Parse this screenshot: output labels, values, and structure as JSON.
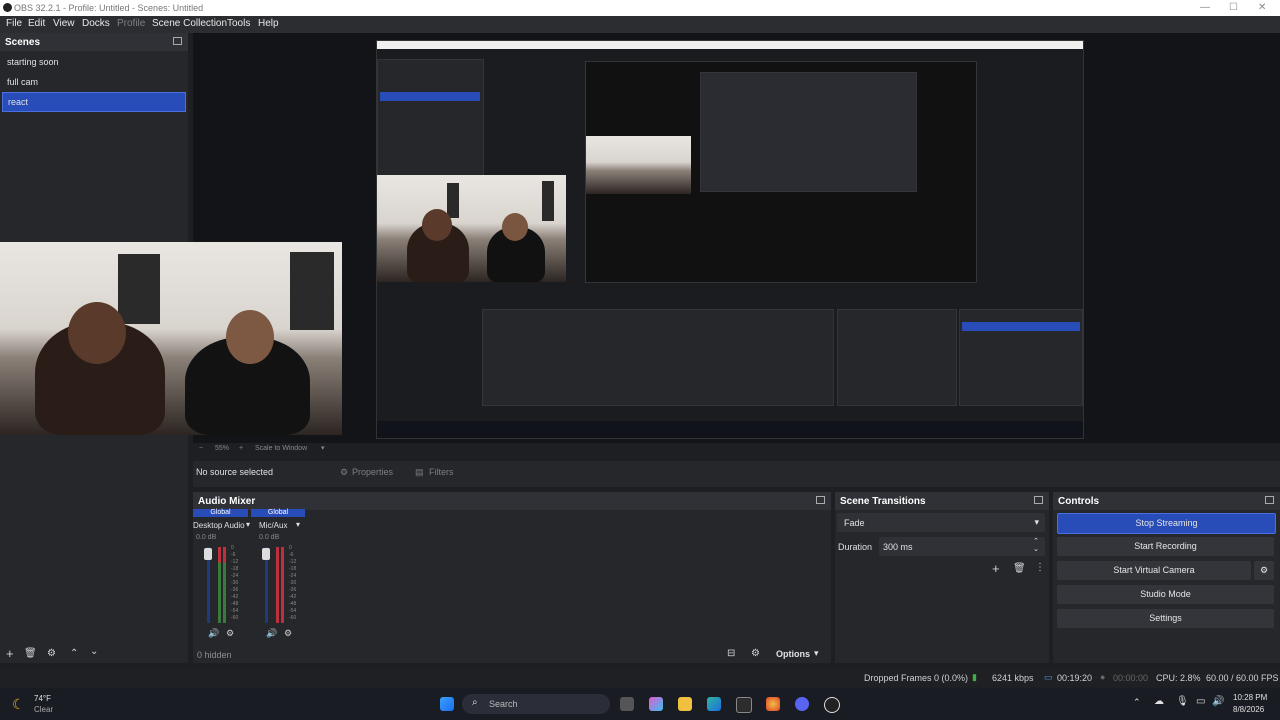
{
  "window": {
    "title": "OBS 32.2.1 - Profile: Untitled - Scenes: Untitled"
  },
  "menu": [
    "File",
    "Edit",
    "View",
    "Docks",
    "Profile",
    "Scene Collection",
    "Tools",
    "Help"
  ],
  "scenes": {
    "title": "Scenes",
    "items": [
      "starting soon",
      "full cam",
      "react"
    ],
    "selected": "react"
  },
  "preview": {
    "scale_minus": "−",
    "scale_value": "55%",
    "scale_plus": "+",
    "scale_mode": "Scale to Window"
  },
  "source_bar": {
    "status": "No source selected",
    "properties": "Properties",
    "filters": "Filters"
  },
  "audio_mixer": {
    "title": "Audio Mixer",
    "channels": [
      {
        "global": "Global",
        "name": "Desktop Audio",
        "db": "0.0 dB"
      },
      {
        "global": "Global",
        "name": "Mic/Aux",
        "db": "0.0 dB"
      }
    ],
    "ticks": [
      "0",
      "-6",
      "-12",
      "-18",
      "-24",
      "-30",
      "-36",
      "-42",
      "-48",
      "-54",
      "-60"
    ],
    "hidden": "0 hidden",
    "options": "Options"
  },
  "scene_transitions": {
    "title": "Scene Transitions",
    "transition": "Fade",
    "duration_label": "Duration",
    "duration_value": "300 ms"
  },
  "controls": {
    "title": "Controls",
    "stop_streaming": "Stop Streaming",
    "start_recording": "Start Recording",
    "start_virtual_camera": "Start Virtual Camera",
    "studio_mode": "Studio Mode",
    "settings": "Settings"
  },
  "status": {
    "dropped_frames": "Dropped Frames 0 (0.0%)",
    "bitrate": "6241 kbps",
    "stream_time": "00:19:20",
    "record_time": "00:00:00",
    "cpu": "CPU: 2.8%",
    "fps": "60.00 / 60.00 FPS"
  },
  "taskbar": {
    "weather_temp": "74°F",
    "weather_desc": "Clear",
    "search": "Search",
    "time": "10:28 PM",
    "date": "8/8/2026"
  },
  "colors": {
    "accent": "#284cb8",
    "background": "#1e1f22",
    "dock": "#26272b"
  }
}
